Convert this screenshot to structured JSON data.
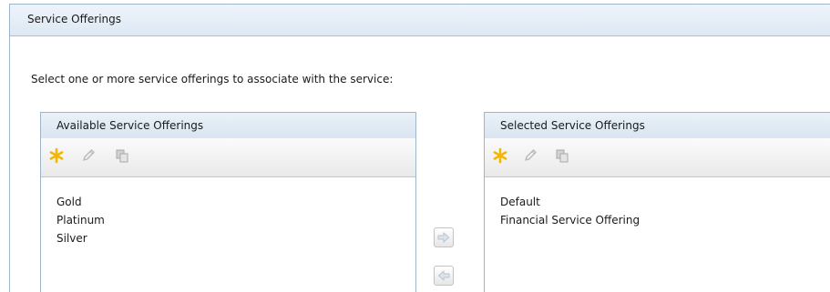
{
  "section": {
    "title": "Service Offerings",
    "instructions": "Select one or more service offerings to associate with the service:"
  },
  "available": {
    "title": "Available Service Offerings",
    "items": [
      "Gold",
      "Platinum",
      "Silver"
    ]
  },
  "selected": {
    "title": "Selected Service Offerings",
    "items": [
      "Default",
      "Financial Service Offering"
    ]
  },
  "toolbar": {
    "icons": [
      "new-asterisk-icon",
      "edit-pencil-icon",
      "copy-icon"
    ],
    "new_icon_color": "#f2b705",
    "disabled_icon_color": "#b8b8b8"
  },
  "transfer": {
    "icons": [
      "arrow-right-icon",
      "arrow-left-icon"
    ],
    "icon_color": "#b8c4cf"
  },
  "colors": {
    "header_border": "#9eb4c8",
    "header_background": "#dde8f3"
  }
}
